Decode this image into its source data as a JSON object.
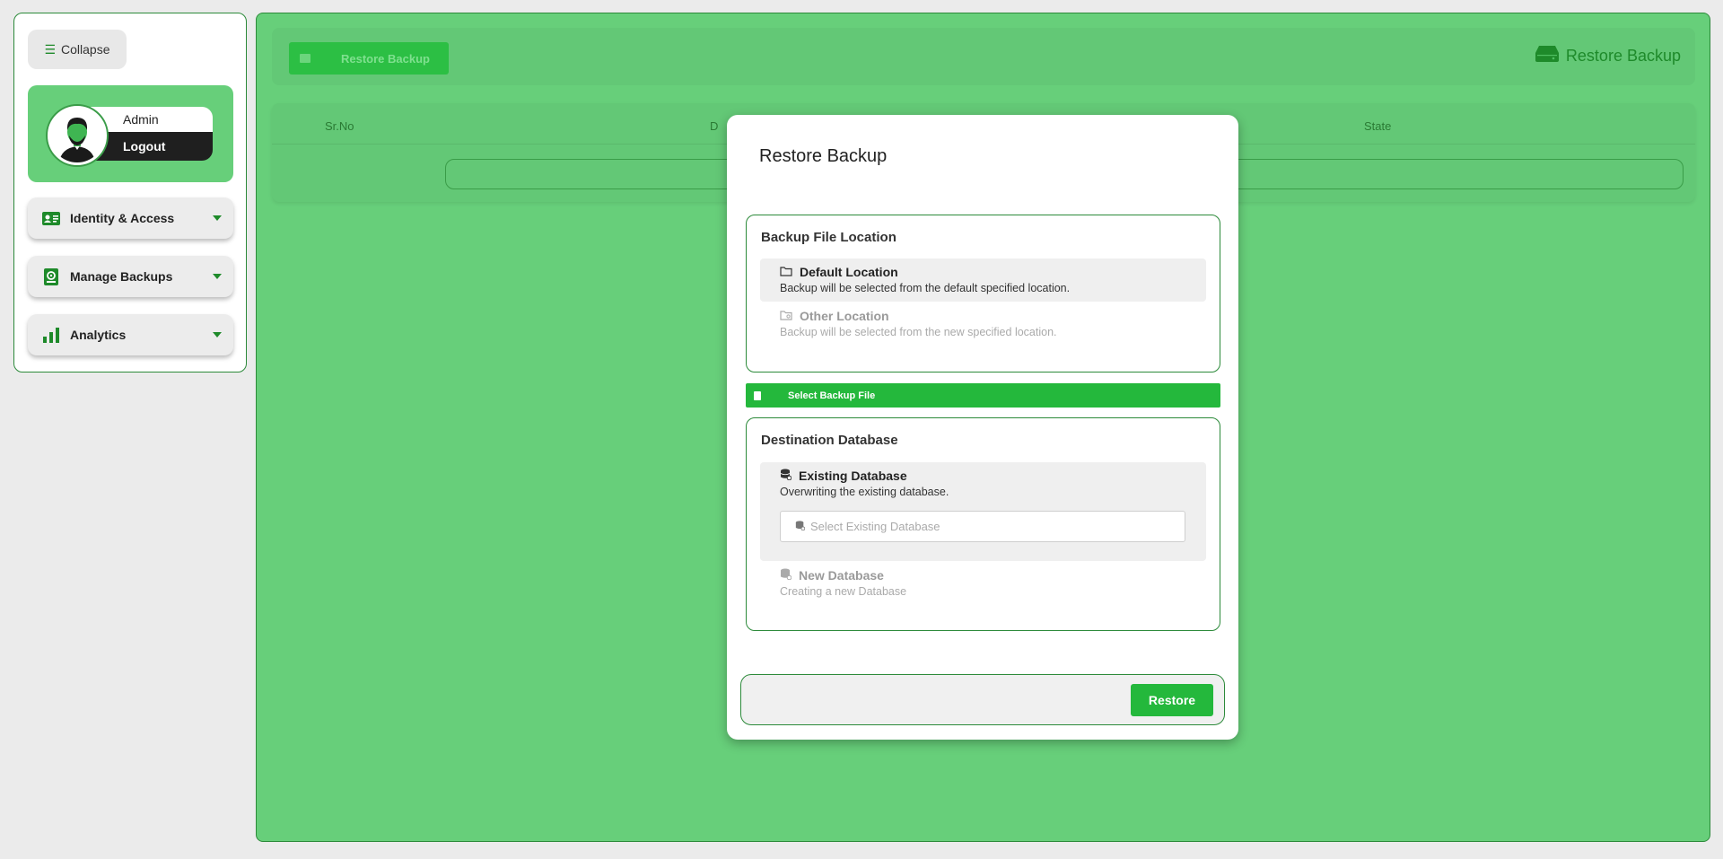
{
  "sidebar": {
    "collapse_label": "Collapse",
    "profile": {
      "name": "Admin",
      "logout_label": "Logout"
    },
    "menu": [
      {
        "label": "Identity & Access",
        "icon": "id-card-icon"
      },
      {
        "label": "Manage Backups",
        "icon": "backup-icon"
      },
      {
        "label": "Analytics",
        "icon": "bar-chart-icon"
      }
    ]
  },
  "main": {
    "top_button_label": "Restore Backup",
    "page_title": "Restore Backup",
    "table": {
      "columns": [
        "Sr.No",
        "D",
        "State"
      ]
    }
  },
  "modal": {
    "title": "Restore Backup",
    "file_location": {
      "title": "Backup File Location",
      "options": [
        {
          "label": "Default Location",
          "description": "Backup will be selected from the default specified location.",
          "icon": "folder-icon",
          "selected": true
        },
        {
          "label": "Other Location",
          "description": "Backup will be selected from the new specified location.",
          "icon": "folder-search-icon",
          "selected": false
        }
      ]
    },
    "select_file_label": "Select Backup File",
    "destination": {
      "title": "Destination Database",
      "options": [
        {
          "label": "Existing Database",
          "description": "Overwriting the existing database.",
          "icon": "database-icon",
          "selected": true
        },
        {
          "label": "New Database",
          "description": "Creating a new Database",
          "icon": "database-add-icon",
          "selected": false
        }
      ],
      "select_placeholder": "Select Existing Database"
    },
    "restore_label": "Restore"
  },
  "colors": {
    "accent": "#24b83c",
    "overlay_green": "#67cf7a",
    "border_green": "#2c8a3a"
  }
}
